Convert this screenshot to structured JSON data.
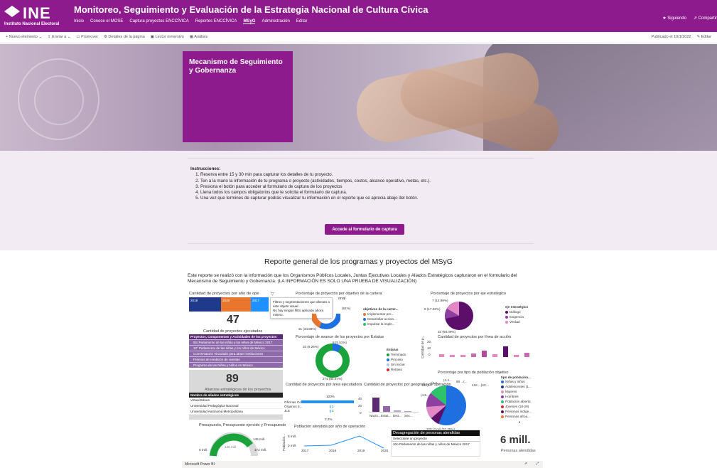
{
  "header": {
    "logo_text": "INE",
    "logo_sub": "Instituto Nacional Electoral",
    "title": "Monitoreo, Seguimiento y Evaluación de la Estrategia Nacional de Cultura Cívica",
    "nav": [
      "Inicio",
      "Conoce el MOSE",
      "Captura proyectos ENCCÍVICA",
      "Reportes ENCCÍVICA",
      "MSyG",
      "Administración",
      "Editar"
    ],
    "following": "★ Siguiendo",
    "share": "⇗ Compartir"
  },
  "commandbar": {
    "new": "+ Nuevo elemento ⌄",
    "send": "⇪ Enviar a ⌄",
    "promote": "▭ Promover",
    "details": "⚙ Detalles de la página",
    "reader": "▣ Lector inmersivo",
    "analytics": "▦ Análisis",
    "published": "Publicado el 10/1/2022",
    "edit": "✎ Editar"
  },
  "hero": {
    "box_title": "Mecanismo de Seguimiento y Gobernanza"
  },
  "instructions": {
    "heading": "Instrucciones:",
    "steps": [
      "Reserva entre 15 y 30 min para capturar los detalles de tu proyecto.",
      "Ten a la mano la información de tu programa o proyecto (actividades, tiempos, costos, alcance operativo, metas, etc.).",
      "Presiona el botón para acceder al formulario de captura de los proyectos",
      "Llena todos los campos obligatorios que te solicita el formulario de captura.",
      "Una vez que termines de capturar podrás visualizar tu información en el reporte que se aprecia abajo del botón."
    ],
    "button": "Accede al formulario de captura"
  },
  "report": {
    "title": "Reporte general de los programas y proyectos del MSyG",
    "description": "Este reporte se realizó con la información que los Organismos Públicos Locales, Juntas Ejecutivas Locales y Aliados Estratégicos capturaron en el formulario del Mecanismo de Seguimiento y Gobernanza. (LA INFORMACIÓN ES SOLO UNA PRUEBA DE VISUALIZACIÓN)"
  },
  "dashboard": {
    "kpi_projects": {
      "title": "Cantidad de proyectos por año de ope",
      "value": "47",
      "label": "Cantidad de proyectos ejecutados",
      "years": [
        "2019",
        "2020",
        "2017"
      ]
    },
    "tooltip": {
      "line1": "Filtros y segmentaciones que afectan a este objeto visual",
      "line2": "No hay ningún filtro aplicado ahora mismo."
    },
    "objective": {
      "title": "Porcentaje de proyectos por objetivo de la cartera",
      "title2": "onal",
      "pct_a": "31 (34.88%)",
      "pct_b": "(61%)",
      "legend_title": "objetivos de la carter...",
      "legend": [
        "Implementar pro...",
        "Desarrollar accion...",
        "Impulsar la imple..."
      ]
    },
    "axis": {
      "title": "Porcentaje de proyectos por eje estratégico",
      "pct_a": "7 (14.89%)",
      "pct_b": "8 (17.02%)",
      "pct_c": "32 (68.09%)",
      "legend_title": "eje estratégico",
      "legend": [
        "Diálogo",
        "Exigencia",
        "Verdad"
      ]
    },
    "components": {
      "title": "Proyectos, Componentes y Actividades de los proyectos",
      "rows": [
        "5to Parlamento de las niñas y los niños de México 2017",
        "10° Parlamento de las niñas y los niños de México",
        "Conversatorio Vinculado para atraer instituciones",
        "Premios de rendición de cuentas",
        "Programa de las Niñas y Niños en México"
      ]
    },
    "status": {
      "title": "Porcentaje de avance de los proyectos por Estatus",
      "pct_a": "8 (5.51%)",
      "pct_b": "33 (9.26%)",
      "pct_c": "274 (84.57%)",
      "legend_title": "Estatus",
      "legend": [
        "Terminado",
        "Proceso",
        "Sin iniciar",
        "Retraso"
      ]
    },
    "line_action": {
      "title": "Cantidad de proyectos por línea de acción",
      "ylabel": "Cantidad de p...",
      "yticks": [
        "20",
        "10",
        "0"
      ]
    },
    "allies": {
      "value": "89",
      "label": "Alianzas estratégicas de los proyectos",
      "col": "Nombre de aliados estratégicos",
      "rows": [
        "Virtual Educa",
        "Universidad Pedagógica Nacional",
        "Universidad Autónoma Metropolitana"
      ]
    },
    "area": {
      "title": "Cantidad de proyectos por área ejecutadora",
      "pct": "100%",
      "rows": [
        "Oficinas Ce...",
        "Órganos d...",
        "JLE"
      ],
      "values": [
        "1",
        "1"
      ],
      "foot": "2.2%"
    },
    "geo": {
      "title": "Cantidad de proyectos por geografía de operación",
      "ylabel": "Cantidad de...",
      "yticks": [
        "40",
        "20",
        "0"
      ],
      "xlabels": [
        "Nacio...",
        "Estat...",
        "Dist...",
        "Sec..."
      ]
    },
    "population": {
      "title": "Porcentaje por tipo de población objetivo",
      "labels": [
        "31 (5...",
        "(6.2...",
        "(4.4...",
        "(4.5...",
        "416 ...(4C...",
        "86 ...(...",
        "325 (7 mil (22.25%)"
      ],
      "legend_title": "tipo de población...",
      "legend": [
        "Niñas y niños",
        "Adolescentes (1...",
        "Mujeres",
        "Hombres",
        "Población abierta",
        "Jóvenes (18-29)",
        "Personas indíge...",
        "Personas afroa..."
      ]
    },
    "budget": {
      "title": "Presupuesto, Presupuesto ejercido y Presupuesto",
      "left": "0 mill.",
      "mid": "145 mill.",
      "right1": "145 mill.",
      "right2": "172 mill."
    },
    "attended": {
      "title": "Población atendida por año de operación",
      "ylabel": "Población...",
      "yticks": [
        "5 mill.",
        "0 mill."
      ],
      "xlabels": [
        "2017",
        "2018",
        "2019",
        "2020"
      ]
    },
    "disagg": {
      "title": "Desagregación de personas atendidas",
      "select": "Seleccione un proyecto",
      "item": "10o Parlamento de las niñas y niños de México 2017"
    },
    "people": {
      "value": "6 mill.",
      "label": "Personas atendidas"
    }
  },
  "footer": {
    "brand": "Microsoft Power BI"
  },
  "colors": {
    "brand": "#8e1b8e",
    "donut_blue": "#1e6fe0",
    "donut_orange": "#e8762d",
    "status_green": "#1aa33a",
    "purple_dark": "#5b0f6b",
    "pink": "#e487c6",
    "bar_blue": "#1e90ff"
  }
}
